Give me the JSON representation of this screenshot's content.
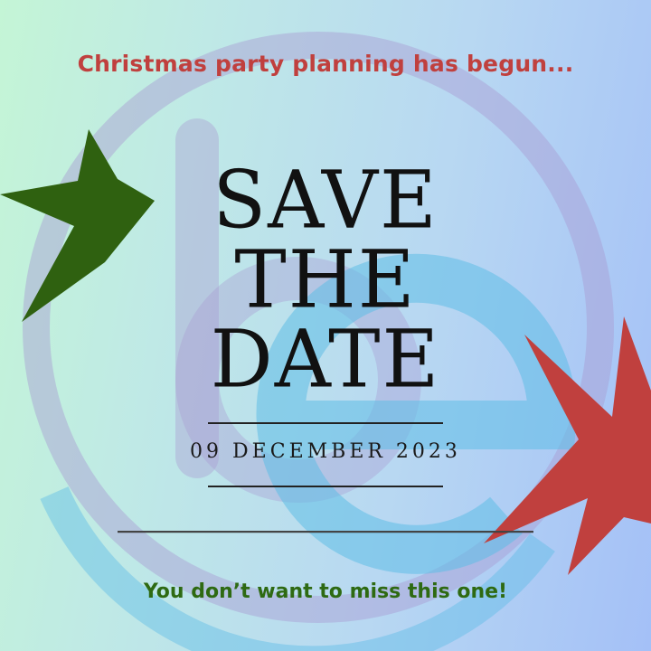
{
  "poster": {
    "tagline_top": "Christmas party planning has begun...",
    "title_lines": [
      "SAVE",
      "THE",
      "DATE"
    ],
    "event_date": "09 DECEMBER 2023",
    "tagline_bottom": "You don’t want to miss this one!"
  },
  "colors": {
    "tagline_top": "#c0403e",
    "tagline_bottom": "#2e6a12",
    "title": "#111111",
    "star_green": "#2f6110",
    "star_red": "#c0403e",
    "logo_purple": "#a98fd0",
    "logo_blue": "#5fbde6",
    "background_start": "#c4f5d6",
    "background_end": "#a4c0f7"
  },
  "icons": {
    "decoration_left": "green-star-icon",
    "decoration_right": "red-star-icon",
    "watermark": "be-logo-watermark"
  }
}
